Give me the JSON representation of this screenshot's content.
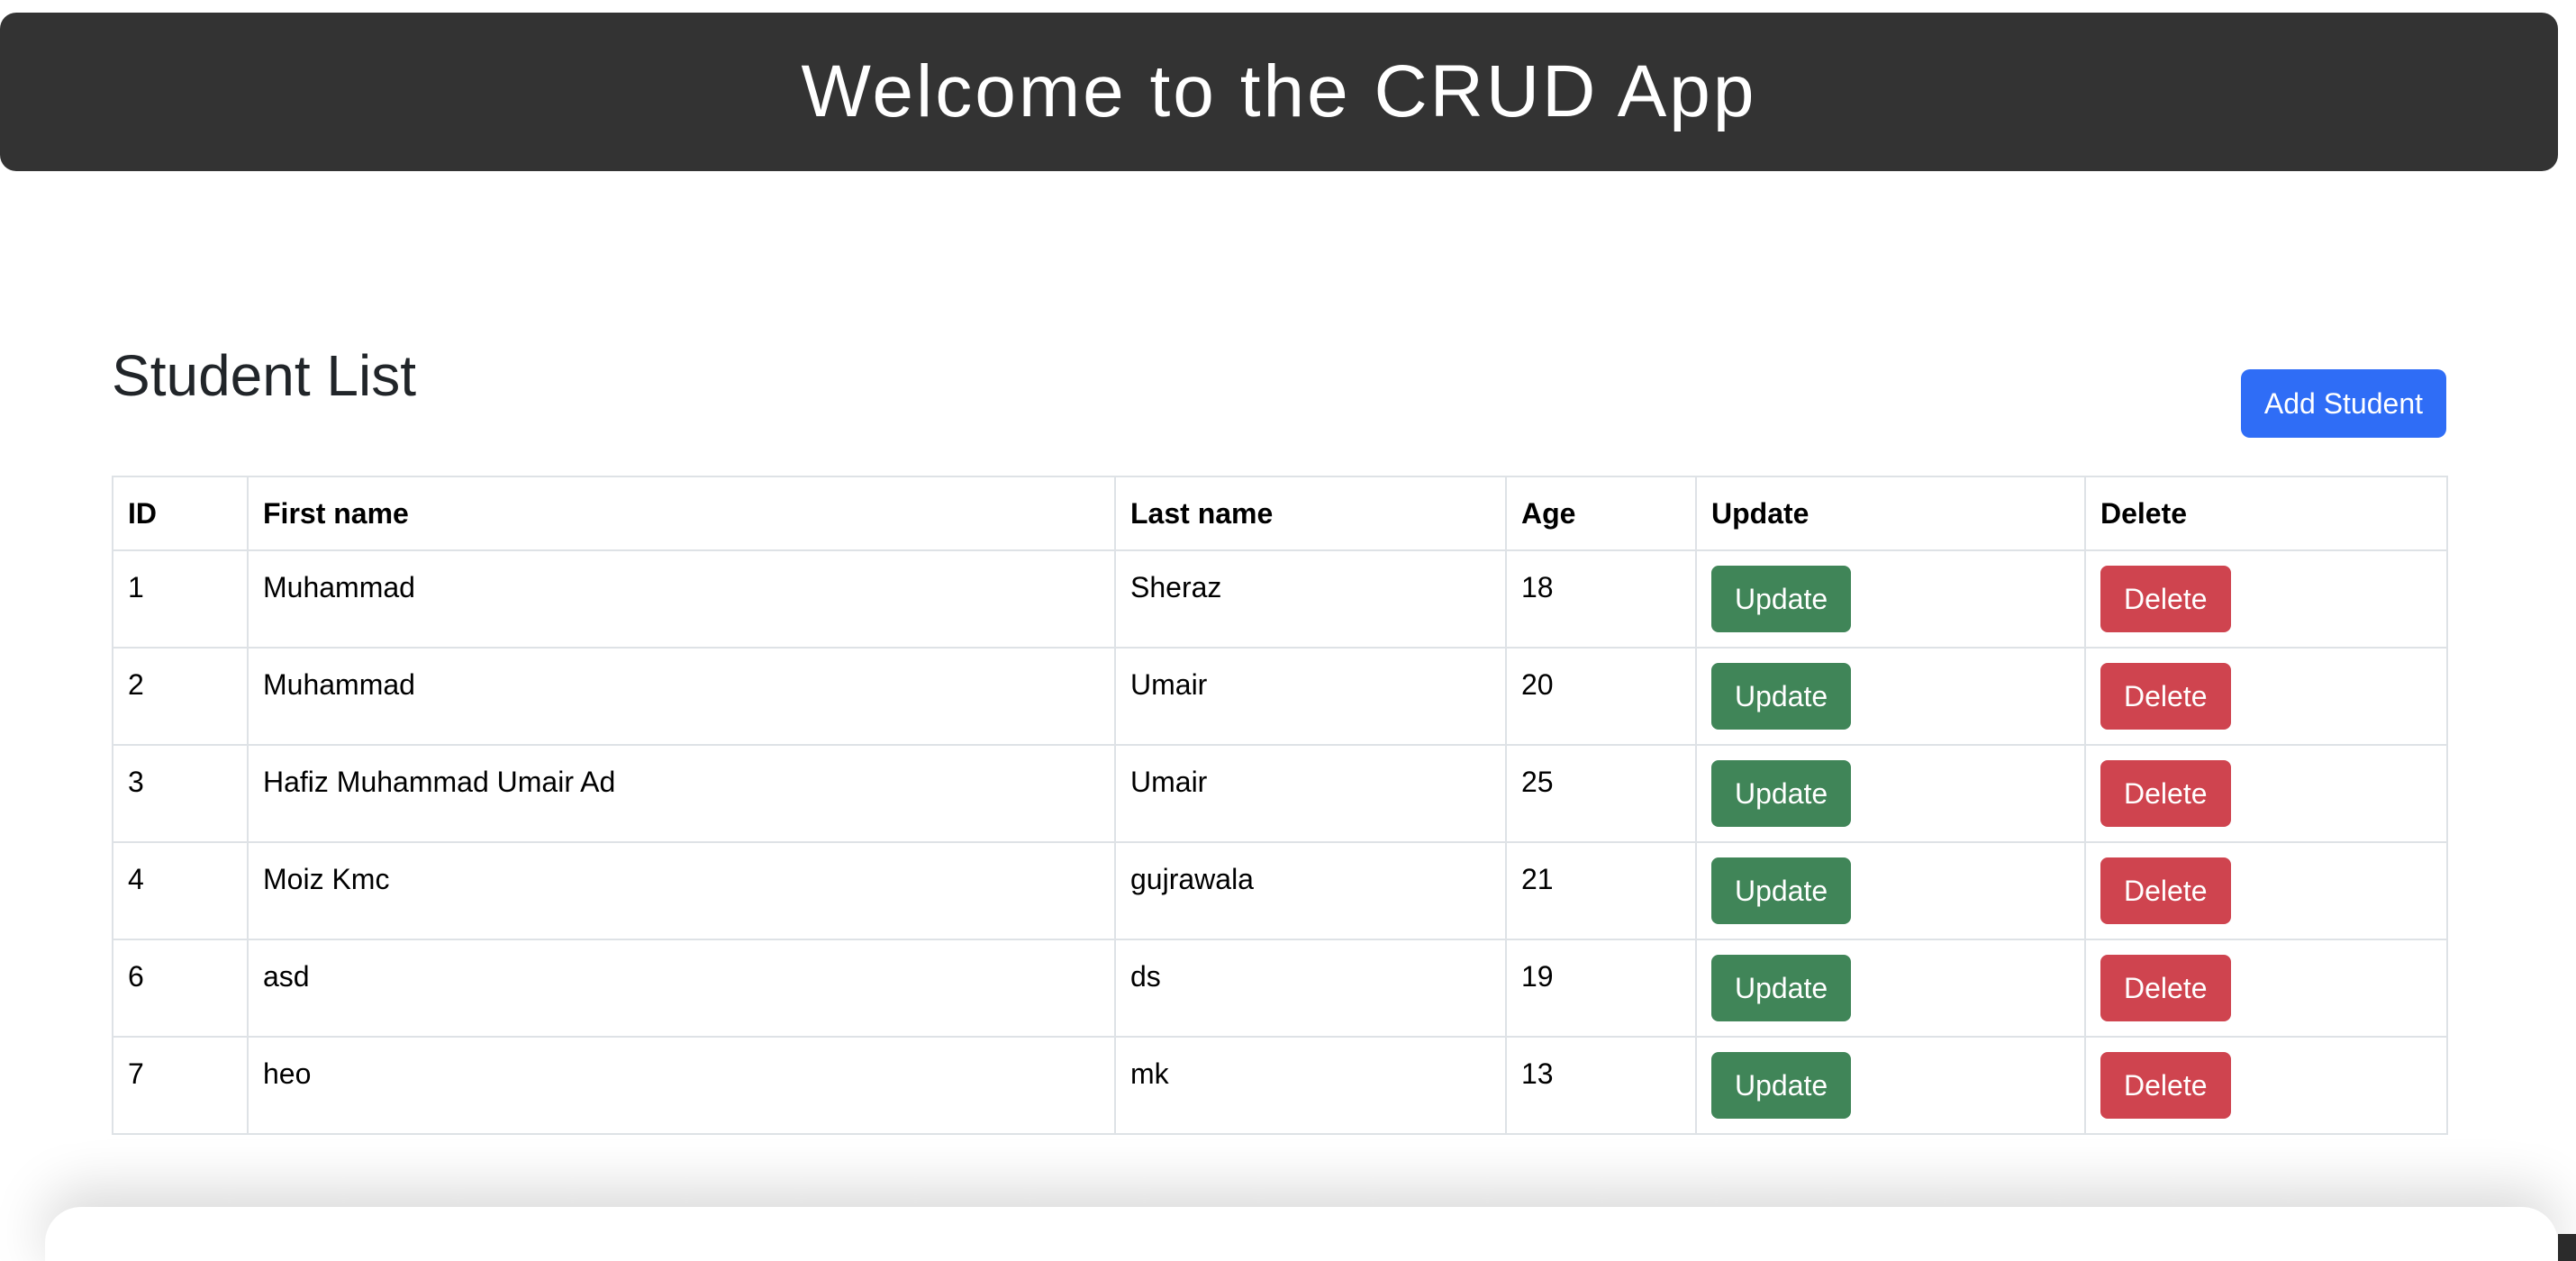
{
  "header": {
    "title": "Welcome to the CRUD App"
  },
  "student_list": {
    "title": "Student List",
    "add_button_label": "Add Student",
    "columns": [
      "ID",
      "First name",
      "Last name",
      "Age",
      "Update",
      "Delete"
    ],
    "rows": [
      {
        "id": "1",
        "first_name": "Muhammad",
        "last_name": "Sheraz",
        "age": "18",
        "update_label": "Update",
        "delete_label": "Delete"
      },
      {
        "id": "2",
        "first_name": "Muhammad",
        "last_name": "Umair",
        "age": "20",
        "update_label": "Update",
        "delete_label": "Delete"
      },
      {
        "id": "3",
        "first_name": "Hafiz Muhammad Umair Ad",
        "last_name": "Umair",
        "age": "25",
        "update_label": "Update",
        "delete_label": "Delete"
      },
      {
        "id": "4",
        "first_name": "Moiz Kmc",
        "last_name": "gujrawala",
        "age": "21",
        "update_label": "Update",
        "delete_label": "Delete"
      },
      {
        "id": "6",
        "first_name": "asd",
        "last_name": "ds",
        "age": "19",
        "update_label": "Update",
        "delete_label": "Delete"
      },
      {
        "id": "7",
        "first_name": "heo",
        "last_name": "mk",
        "age": "13",
        "update_label": "Update",
        "delete_label": "Delete"
      }
    ]
  },
  "colors": {
    "header_bg": "#333333",
    "primary": "#2f6df6",
    "success": "#408558",
    "danger": "#cf444f",
    "border": "#dee2e6"
  }
}
